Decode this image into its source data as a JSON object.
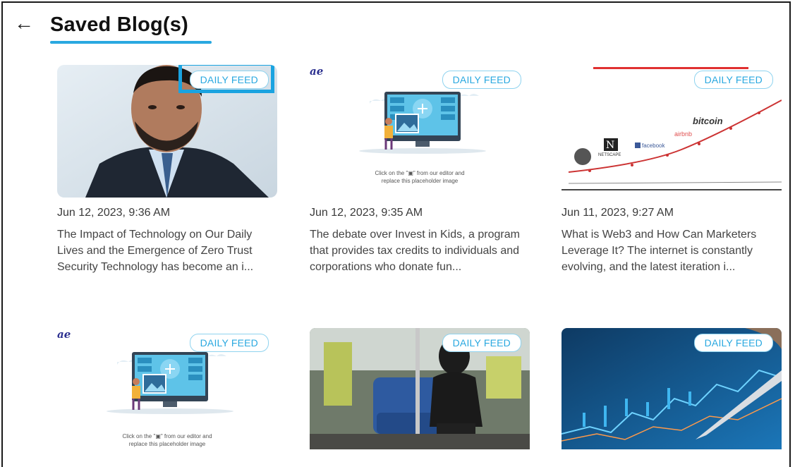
{
  "header": {
    "back_icon": "arrow-left-icon",
    "title": "Saved Blog(s)"
  },
  "cards": [
    {
      "badge": "DAILY FEED",
      "date": "Jun 12, 2023, 9:36 AM",
      "excerpt": "The Impact of Technology on Our Daily Lives and the Emergence of Zero Trust Security Technology has become an i...",
      "image": "portrait-photo"
    },
    {
      "badge": "DAILY FEED",
      "date": "Jun 12, 2023, 9:35 AM",
      "excerpt": "The debate over Invest in Kids, a program that provides tax credits to individuals and corporations who donate fun...",
      "image": "placeholder-illustration",
      "logo": "ae",
      "caption_line1": "Click on the \"▣\" from our editor and",
      "caption_line2": "replace this placeholder image"
    },
    {
      "badge": "DAILY FEED",
      "date": "Jun 11, 2023, 9:27 AM",
      "excerpt": "What is Web3 and How Can Marketers Leverage It? The internet is constantly evolving, and the latest iteration i...",
      "image": "internet-growth-chart",
      "brands": [
        "bitcoin",
        "airbnb",
        "facebook",
        "NETSCAPE"
      ]
    },
    {
      "badge": "DAILY FEED",
      "image": "placeholder-illustration",
      "logo": "ae",
      "caption_line1": "Click on the \"▣\" from our editor and",
      "caption_line2": "replace this placeholder image"
    },
    {
      "badge": "DAILY FEED",
      "image": "train-interior-photo"
    },
    {
      "badge": "DAILY FEED",
      "image": "finance-chart-photo"
    }
  ],
  "colors": {
    "accent": "#29a8e0",
    "badge_border": "#8fd3ef",
    "text": "#444444"
  }
}
